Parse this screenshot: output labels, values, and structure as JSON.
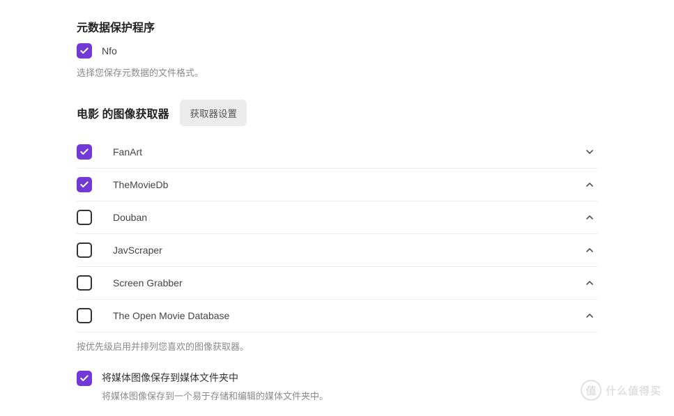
{
  "metadata": {
    "title": "元数据保护程序",
    "nfo_label": "Nfo",
    "help": "选择您保存元数据的文件格式。"
  },
  "fetchers": {
    "title": "电影 的图像获取器",
    "settings_btn": "获取器设置",
    "items": [
      {
        "label": "FanArt",
        "checked": true,
        "expanded": false
      },
      {
        "label": "TheMovieDb",
        "checked": true,
        "expanded": true
      },
      {
        "label": "Douban",
        "checked": false,
        "expanded": true
      },
      {
        "label": "JavScraper",
        "checked": false,
        "expanded": true
      },
      {
        "label": "Screen Grabber",
        "checked": false,
        "expanded": true
      },
      {
        "label": "The Open Movie Database",
        "checked": false,
        "expanded": true
      }
    ],
    "help": "按优先级启用并排列您喜欢的图像获取器。"
  },
  "save_media": {
    "title": "将媒体图像保存到媒体文件夹中",
    "desc": "将媒体图像保存到一个易于存储和编辑的媒体文件夹中。"
  },
  "watermark": {
    "glyph": "值",
    "text": "什么值得买"
  }
}
